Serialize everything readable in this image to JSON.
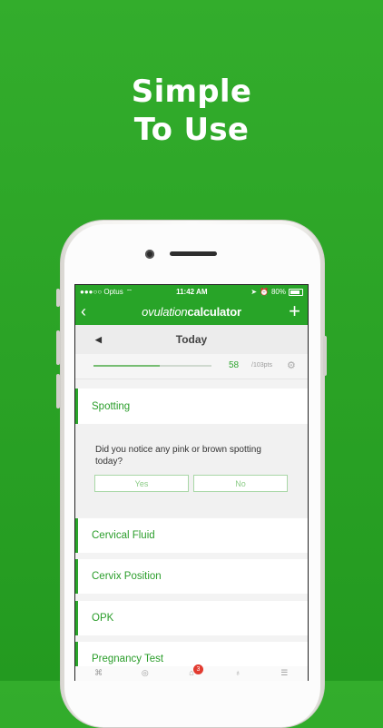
{
  "headline": {
    "line1": "Simple",
    "line2": "To Use"
  },
  "status_bar": {
    "carrier": "●●●○○ Optus",
    "time": "11:42 AM",
    "battery": "80%"
  },
  "nav": {
    "logo_part1": "ovulation",
    "logo_part2": "calculator",
    "back_icon": "‹",
    "add_icon": "+"
  },
  "date_bar": {
    "title": "Today",
    "prev_icon": "◀"
  },
  "points": {
    "value": "58",
    "total": "/103pts",
    "progress_fraction": 0.56
  },
  "sections": {
    "spotting": "Spotting",
    "question": "Did you notice any pink or brown spotting today?",
    "yes": "Yes",
    "no": "No",
    "cervical_fluid": "Cervical Fluid",
    "cervix_position": "Cervix Position",
    "opk": "OPK",
    "pregnancy_test": "Pregnancy Test"
  },
  "tabbar": {
    "badge": "3"
  },
  "colors": {
    "accent": "#28a428",
    "background": "#2ba326",
    "badge": "#e23b30"
  }
}
